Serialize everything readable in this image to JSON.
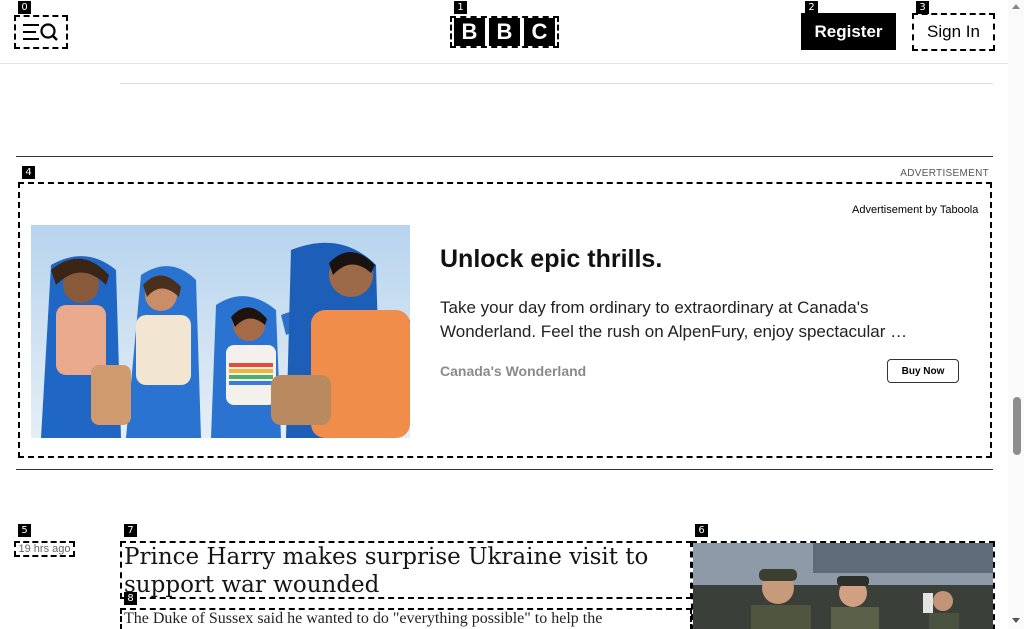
{
  "header": {
    "logo_letters": [
      "B",
      "B",
      "C"
    ],
    "register_label": "Register",
    "signin_label": "Sign In",
    "menu_icon": "menu-search-icon"
  },
  "markers": [
    "0",
    "1",
    "2",
    "3",
    "4",
    "5",
    "6",
    "7",
    "8"
  ],
  "advertisement": {
    "label": "ADVERTISEMENT",
    "by": "Advertisement by Taboola",
    "headline": "Unlock epic thrills.",
    "description_line1": "Take your day from ordinary to extraordinary at Canada's",
    "description_line2": "Wonderland. Feel the rush on AlpenFury, enjoy spectacular …",
    "brand": "Canada's Wonderland",
    "cta": "Buy Now"
  },
  "article": {
    "timestamp": "19 hrs ago",
    "headline": "Prince Harry makes surprise Ukraine visit to support war wounded",
    "summary": "The Duke of Sussex said he wanted to do \"everything possible\" to help the"
  }
}
